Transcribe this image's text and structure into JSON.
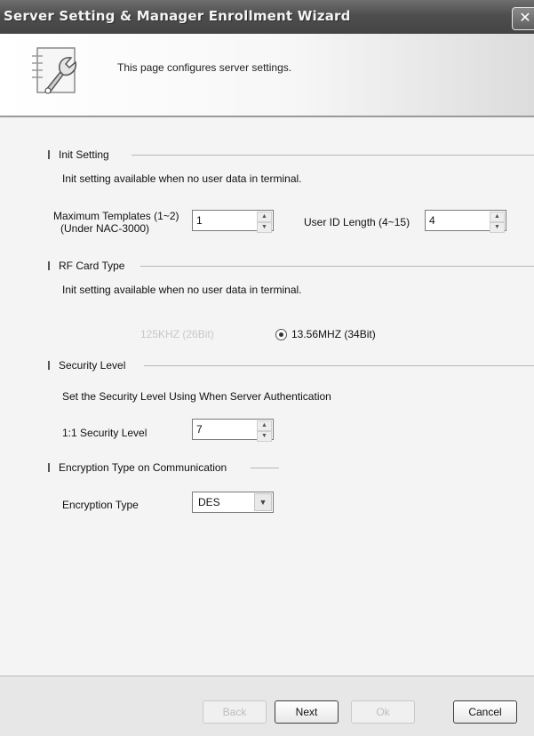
{
  "window": {
    "title": "Server Setting & Manager Enrollment Wizard",
    "close_label": "✕"
  },
  "banner": {
    "description": "This page configures server settings.",
    "icon": "wrench-document-icon"
  },
  "init_setting": {
    "heading": "Init Setting",
    "note": "Init setting available when no user data in terminal.",
    "max_templates_label_line1": "Maximum Templates (1~2)",
    "max_templates_label_line2": "(Under NAC-3000)",
    "max_templates_value": "1",
    "user_id_length_label": "User ID Length (4~15)",
    "user_id_length_value": "4"
  },
  "rf_card": {
    "heading": "RF Card Type",
    "note": "Init setting available when no user data in terminal.",
    "option_125": "125KHZ (26Bit)",
    "option_1356": "13.56MHZ (34Bit)",
    "selected": "13.56MHZ (34Bit)"
  },
  "security": {
    "heading": "Security Level",
    "note": "Set the Security Level Using When Server Authentication",
    "level_label": "1:1 Security Level",
    "level_value": "7"
  },
  "encryption": {
    "heading": "Encryption Type on Communication",
    "type_label": "Encryption Type",
    "type_value": "DES"
  },
  "buttons": {
    "back": "Back",
    "next": "Next",
    "ok": "Ok",
    "cancel": "Cancel"
  }
}
